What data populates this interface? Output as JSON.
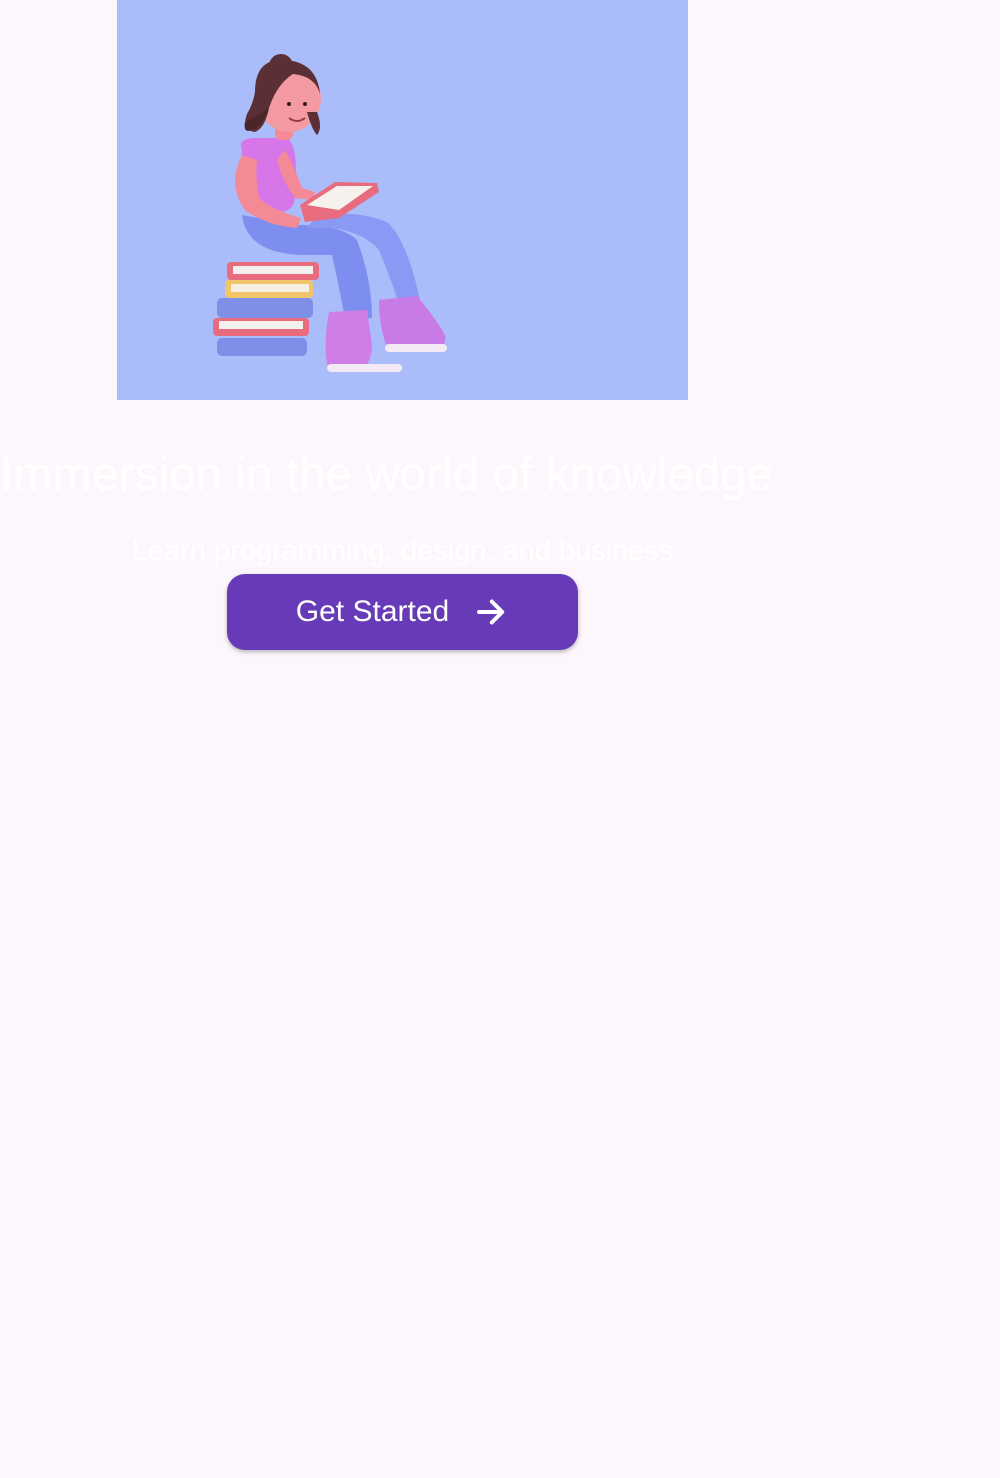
{
  "hero": {
    "illustration": "girl-reading-book-on-stack-of-books",
    "background_color": "#aabdfa"
  },
  "headline": "Immersion in the world of knowledge",
  "subtitle": "Learn programming, design, and business",
  "cta": {
    "label": "Get Started",
    "icon": "arrow-right-icon",
    "color": "#673ab7"
  },
  "colors": {
    "page_background": "#fdf7fd",
    "text": "#ffffff"
  }
}
